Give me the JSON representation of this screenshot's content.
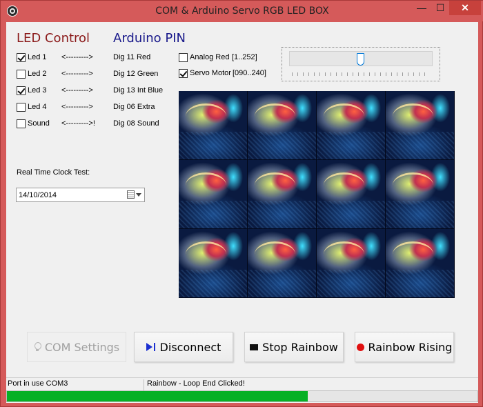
{
  "window": {
    "title": "COM & Arduino Servo RGB LED BOX",
    "controls": {
      "minimize": "—",
      "maximize": "☐",
      "close": "✕"
    }
  },
  "headings": {
    "led_control": "LED Control",
    "arduino_pin": "Arduino PIN"
  },
  "leds": [
    {
      "label": "Led 1",
      "checked": true,
      "arrow": "<--------->",
      "pin": "Dig 11 Red"
    },
    {
      "label": "Led 2",
      "checked": false,
      "arrow": "<--------->",
      "pin": "Dig 12 Green"
    },
    {
      "label": "Led 3",
      "checked": true,
      "arrow": "<--------->",
      "pin": "Dig 13 Int Blue"
    },
    {
      "label": "Led 4",
      "checked": false,
      "arrow": "<--------->",
      "pin": "Dig 06 Extra"
    },
    {
      "label": "Sound",
      "checked": false,
      "arrow": "<--------->!",
      "pin": "Dig 08 Sound"
    }
  ],
  "options": {
    "analog_red": {
      "label": "Analog Red",
      "range": "[1..252]",
      "checked": false
    },
    "servo_motor": {
      "label": "Servo Motor",
      "range": "[090..240]",
      "checked": true
    }
  },
  "slider": {
    "value_fraction": 0.5
  },
  "rtc": {
    "label": "Real Time Clock Test:",
    "date": "14/10/2014"
  },
  "buttons": {
    "com_settings": "COM Settings",
    "disconnect": "Disconnect",
    "stop_rainbow": "Stop Rainbow",
    "rainbow_rising": "Rainbow Rising"
  },
  "status": {
    "port": "Port in use COM3",
    "message": "Rainbow - Loop End Clicked!"
  },
  "progress": {
    "fraction": 0.64
  },
  "colors": {
    "titlebar": "#d55a5a",
    "led_heading": "#8b1a1a",
    "pin_heading": "#1a1a8b",
    "progress_fill": "#06b025"
  }
}
